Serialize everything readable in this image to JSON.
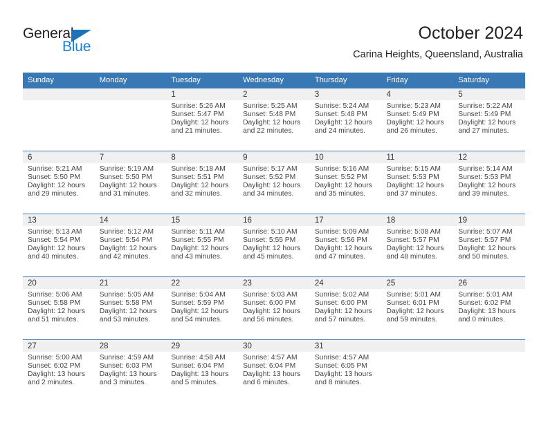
{
  "brand": {
    "name_top": "General",
    "name_bottom": "Blue",
    "accent_color": "#1b7fd4",
    "triangle_color": "#1e72b8"
  },
  "header": {
    "title": "October 2024",
    "subtitle": "Carina Heights, Queensland, Australia"
  },
  "theme": {
    "header_bar_color": "#3878b4",
    "date_strip_color": "#f0f0f0",
    "text_color": "#444444"
  },
  "weekday_headers": [
    "Sunday",
    "Monday",
    "Tuesday",
    "Wednesday",
    "Thursday",
    "Friday",
    "Saturday"
  ],
  "weeks": [
    [
      {
        "day": "",
        "empty": true,
        "sunrise": "",
        "sunset": "",
        "daylight_line1": "",
        "daylight_line2": ""
      },
      {
        "day": "",
        "empty": true,
        "sunrise": "",
        "sunset": "",
        "daylight_line1": "",
        "daylight_line2": ""
      },
      {
        "day": "1",
        "sunrise": "Sunrise: 5:26 AM",
        "sunset": "Sunset: 5:47 PM",
        "daylight_line1": "Daylight: 12 hours",
        "daylight_line2": "and 21 minutes."
      },
      {
        "day": "2",
        "sunrise": "Sunrise: 5:25 AM",
        "sunset": "Sunset: 5:48 PM",
        "daylight_line1": "Daylight: 12 hours",
        "daylight_line2": "and 22 minutes."
      },
      {
        "day": "3",
        "sunrise": "Sunrise: 5:24 AM",
        "sunset": "Sunset: 5:48 PM",
        "daylight_line1": "Daylight: 12 hours",
        "daylight_line2": "and 24 minutes."
      },
      {
        "day": "4",
        "sunrise": "Sunrise: 5:23 AM",
        "sunset": "Sunset: 5:49 PM",
        "daylight_line1": "Daylight: 12 hours",
        "daylight_line2": "and 26 minutes."
      },
      {
        "day": "5",
        "sunrise": "Sunrise: 5:22 AM",
        "sunset": "Sunset: 5:49 PM",
        "daylight_line1": "Daylight: 12 hours",
        "daylight_line2": "and 27 minutes."
      }
    ],
    [
      {
        "day": "6",
        "sunrise": "Sunrise: 5:21 AM",
        "sunset": "Sunset: 5:50 PM",
        "daylight_line1": "Daylight: 12 hours",
        "daylight_line2": "and 29 minutes."
      },
      {
        "day": "7",
        "sunrise": "Sunrise: 5:19 AM",
        "sunset": "Sunset: 5:50 PM",
        "daylight_line1": "Daylight: 12 hours",
        "daylight_line2": "and 31 minutes."
      },
      {
        "day": "8",
        "sunrise": "Sunrise: 5:18 AM",
        "sunset": "Sunset: 5:51 PM",
        "daylight_line1": "Daylight: 12 hours",
        "daylight_line2": "and 32 minutes."
      },
      {
        "day": "9",
        "sunrise": "Sunrise: 5:17 AM",
        "sunset": "Sunset: 5:52 PM",
        "daylight_line1": "Daylight: 12 hours",
        "daylight_line2": "and 34 minutes."
      },
      {
        "day": "10",
        "sunrise": "Sunrise: 5:16 AM",
        "sunset": "Sunset: 5:52 PM",
        "daylight_line1": "Daylight: 12 hours",
        "daylight_line2": "and 35 minutes."
      },
      {
        "day": "11",
        "sunrise": "Sunrise: 5:15 AM",
        "sunset": "Sunset: 5:53 PM",
        "daylight_line1": "Daylight: 12 hours",
        "daylight_line2": "and 37 minutes."
      },
      {
        "day": "12",
        "sunrise": "Sunrise: 5:14 AM",
        "sunset": "Sunset: 5:53 PM",
        "daylight_line1": "Daylight: 12 hours",
        "daylight_line2": "and 39 minutes."
      }
    ],
    [
      {
        "day": "13",
        "sunrise": "Sunrise: 5:13 AM",
        "sunset": "Sunset: 5:54 PM",
        "daylight_line1": "Daylight: 12 hours",
        "daylight_line2": "and 40 minutes."
      },
      {
        "day": "14",
        "sunrise": "Sunrise: 5:12 AM",
        "sunset": "Sunset: 5:54 PM",
        "daylight_line1": "Daylight: 12 hours",
        "daylight_line2": "and 42 minutes."
      },
      {
        "day": "15",
        "sunrise": "Sunrise: 5:11 AM",
        "sunset": "Sunset: 5:55 PM",
        "daylight_line1": "Daylight: 12 hours",
        "daylight_line2": "and 43 minutes."
      },
      {
        "day": "16",
        "sunrise": "Sunrise: 5:10 AM",
        "sunset": "Sunset: 5:55 PM",
        "daylight_line1": "Daylight: 12 hours",
        "daylight_line2": "and 45 minutes."
      },
      {
        "day": "17",
        "sunrise": "Sunrise: 5:09 AM",
        "sunset": "Sunset: 5:56 PM",
        "daylight_line1": "Daylight: 12 hours",
        "daylight_line2": "and 47 minutes."
      },
      {
        "day": "18",
        "sunrise": "Sunrise: 5:08 AM",
        "sunset": "Sunset: 5:57 PM",
        "daylight_line1": "Daylight: 12 hours",
        "daylight_line2": "and 48 minutes."
      },
      {
        "day": "19",
        "sunrise": "Sunrise: 5:07 AM",
        "sunset": "Sunset: 5:57 PM",
        "daylight_line1": "Daylight: 12 hours",
        "daylight_line2": "and 50 minutes."
      }
    ],
    [
      {
        "day": "20",
        "sunrise": "Sunrise: 5:06 AM",
        "sunset": "Sunset: 5:58 PM",
        "daylight_line1": "Daylight: 12 hours",
        "daylight_line2": "and 51 minutes."
      },
      {
        "day": "21",
        "sunrise": "Sunrise: 5:05 AM",
        "sunset": "Sunset: 5:58 PM",
        "daylight_line1": "Daylight: 12 hours",
        "daylight_line2": "and 53 minutes."
      },
      {
        "day": "22",
        "sunrise": "Sunrise: 5:04 AM",
        "sunset": "Sunset: 5:59 PM",
        "daylight_line1": "Daylight: 12 hours",
        "daylight_line2": "and 54 minutes."
      },
      {
        "day": "23",
        "sunrise": "Sunrise: 5:03 AM",
        "sunset": "Sunset: 6:00 PM",
        "daylight_line1": "Daylight: 12 hours",
        "daylight_line2": "and 56 minutes."
      },
      {
        "day": "24",
        "sunrise": "Sunrise: 5:02 AM",
        "sunset": "Sunset: 6:00 PM",
        "daylight_line1": "Daylight: 12 hours",
        "daylight_line2": "and 57 minutes."
      },
      {
        "day": "25",
        "sunrise": "Sunrise: 5:01 AM",
        "sunset": "Sunset: 6:01 PM",
        "daylight_line1": "Daylight: 12 hours",
        "daylight_line2": "and 59 minutes."
      },
      {
        "day": "26",
        "sunrise": "Sunrise: 5:01 AM",
        "sunset": "Sunset: 6:02 PM",
        "daylight_line1": "Daylight: 13 hours",
        "daylight_line2": "and 0 minutes."
      }
    ],
    [
      {
        "day": "27",
        "sunrise": "Sunrise: 5:00 AM",
        "sunset": "Sunset: 6:02 PM",
        "daylight_line1": "Daylight: 13 hours",
        "daylight_line2": "and 2 minutes."
      },
      {
        "day": "28",
        "sunrise": "Sunrise: 4:59 AM",
        "sunset": "Sunset: 6:03 PM",
        "daylight_line1": "Daylight: 13 hours",
        "daylight_line2": "and 3 minutes."
      },
      {
        "day": "29",
        "sunrise": "Sunrise: 4:58 AM",
        "sunset": "Sunset: 6:04 PM",
        "daylight_line1": "Daylight: 13 hours",
        "daylight_line2": "and 5 minutes."
      },
      {
        "day": "30",
        "sunrise": "Sunrise: 4:57 AM",
        "sunset": "Sunset: 6:04 PM",
        "daylight_line1": "Daylight: 13 hours",
        "daylight_line2": "and 6 minutes."
      },
      {
        "day": "31",
        "sunrise": "Sunrise: 4:57 AM",
        "sunset": "Sunset: 6:05 PM",
        "daylight_line1": "Daylight: 13 hours",
        "daylight_line2": "and 8 minutes."
      },
      {
        "day": "",
        "empty": true,
        "sunrise": "",
        "sunset": "",
        "daylight_line1": "",
        "daylight_line2": ""
      },
      {
        "day": "",
        "empty": true,
        "sunrise": "",
        "sunset": "",
        "daylight_line1": "",
        "daylight_line2": ""
      }
    ]
  ]
}
